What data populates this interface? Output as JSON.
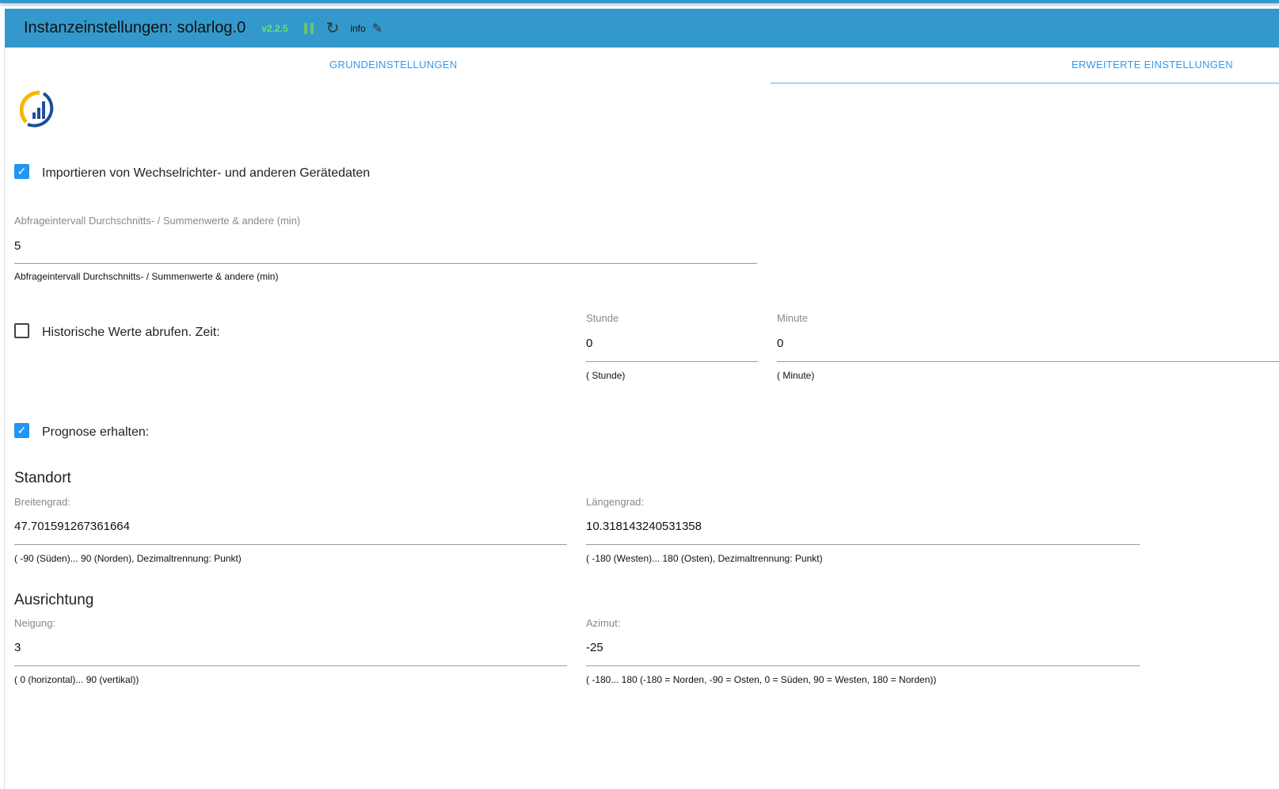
{
  "header": {
    "title": "Instanzeinstellungen: solarlog.0",
    "version": "v2.2.5",
    "info": "info",
    "icons": [
      "pause-icon",
      "refresh-icon",
      "edit-icon"
    ]
  },
  "tabs": [
    {
      "label": "GRUNDEINSTELLUNGEN"
    },
    {
      "label": "ERWEITERTE EINSTELLUNGEN",
      "active": true
    }
  ],
  "import": {
    "label": "Importieren von Wechselrichter- und anderen Gerätedaten",
    "checked": true
  },
  "interval": {
    "label": "Abfrageintervall Durchschnitts- / Summenwerte & andere (min)",
    "value": "5",
    "help": "Abfrageintervall Durchschnitts- / Summenwerte & andere (min)"
  },
  "history": {
    "label": "Historische Werte abrufen. Zeit:",
    "checked": false,
    "hour": {
      "label": "Stunde",
      "value": "0",
      "help": "( Stunde)"
    },
    "minute": {
      "label": "Minute",
      "value": "0",
      "help": "( Minute)"
    }
  },
  "forecast": {
    "label": "Prognose erhalten:",
    "checked": true
  },
  "location": {
    "heading": "Standort",
    "lat": {
      "label": "Breitengrad:",
      "value": "47.701591267361664",
      "help": "( -90 (Süden)... 90 (Norden), Dezimaltrennung: Punkt)"
    },
    "lon": {
      "label": "Längengrad:",
      "value": "10.318143240531358",
      "help": "(  -180 (Westen)... 180 (Osten), Dezimaltrennung: Punkt)"
    }
  },
  "orientation": {
    "heading": "Ausrichtung",
    "tilt": {
      "label": "Neigung:",
      "value": "3",
      "help": "( 0 (horizontal)... 90 (vertikal))"
    },
    "azimuth": {
      "label": "Azimut:",
      "value": "-25",
      "help": "( -180... 180 (-180 = Norden, -90 = Osten, 0 = Süden, 90 = Westen, 180 = Norden))"
    }
  }
}
